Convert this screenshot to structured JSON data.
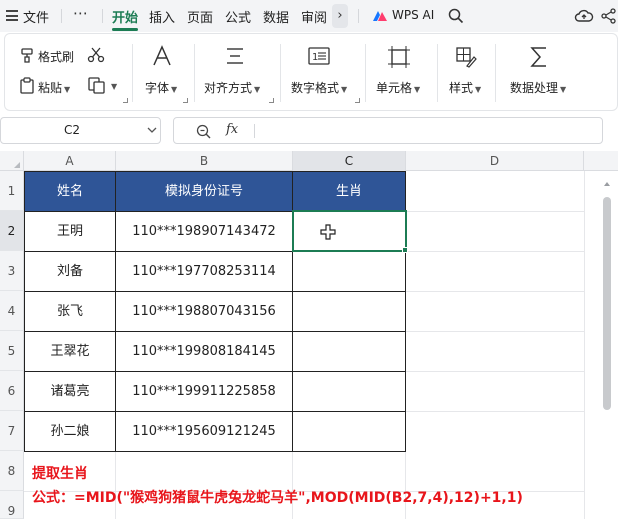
{
  "menubar": {
    "file": "文件",
    "more": "⋯",
    "tabs": [
      "开始",
      "插入",
      "页面",
      "公式",
      "数据",
      "审阅"
    ],
    "wps_ai": "WPS AI"
  },
  "ribbon": {
    "format_painter": "格式刷",
    "paste": "粘贴",
    "font": "字体",
    "align": "对齐方式",
    "number_format": "数字格式",
    "cell": "单元格",
    "style": "样式",
    "data_process": "数据处理"
  },
  "formula_bar": {
    "cell_ref": "C2",
    "fx": "fx",
    "content": ""
  },
  "sheet": {
    "columns": [
      "A",
      "B",
      "C",
      "D"
    ],
    "rows": [
      "1",
      "2",
      "3",
      "4",
      "5",
      "6",
      "7",
      "8",
      "9"
    ],
    "header": [
      "姓名",
      "模拟身份证号",
      "生肖"
    ],
    "data": [
      [
        "王明",
        "110***198907143472",
        ""
      ],
      [
        "刘备",
        "110***197708253114",
        ""
      ],
      [
        "张飞",
        "110***198807043156",
        ""
      ],
      [
        "王翠花",
        "110***199808184145",
        ""
      ],
      [
        "诸葛亮",
        "110***199911225858",
        ""
      ],
      [
        "孙二娘",
        "110***195609121245",
        ""
      ]
    ],
    "selected_cell": "C2",
    "header_fill": "#2f5597"
  },
  "note": {
    "title": "提取生肖",
    "formula": "公式：=MID(\"猴鸡狗猪鼠牛虎兔龙蛇马羊\",MOD(MID(B2,7,4),12)+1,1)",
    "color": "#e8151b"
  }
}
